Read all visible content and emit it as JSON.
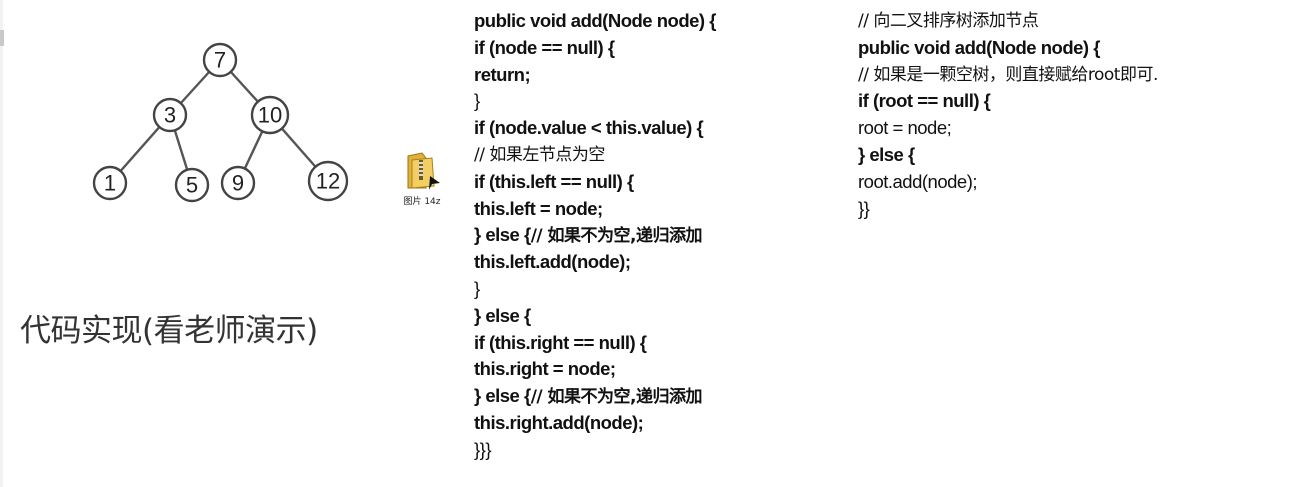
{
  "tree": {
    "nodes": {
      "root": "7",
      "left": "3",
      "right": "10",
      "ll": "1",
      "lr": "5",
      "rl": "9",
      "rr": "12"
    }
  },
  "caption": "代码实现(看老师演示)",
  "file_icon_label": "图片 14z",
  "code_add": [
    "public void add(Node node) {",
    "if (node == null) {",
    "return;",
    "}",
    "if (node.value  < this.value) {",
    "// 如果左节点为空",
    "if (this.left == null) {",
    "this.left = node;",
    "} else {",
    "// 如果不为空,递归添加",
    "this.left.add(node);",
    "}",
    "} else {",
    "if (this.right == null) {",
    "this.right = node;",
    "} else {",
    "// 如果不为空,递归添加",
    "this.right.add(node);",
    "}}}"
  ],
  "code_tree": [
    "// 向二叉排序树添加节点",
    "public void add(Node node) {",
    "// 如果是一颗空树，则直接赋给root即可.",
    "if (root == null) {",
    "root = node;",
    "} else {",
    "root.add(node);",
    "}}"
  ]
}
